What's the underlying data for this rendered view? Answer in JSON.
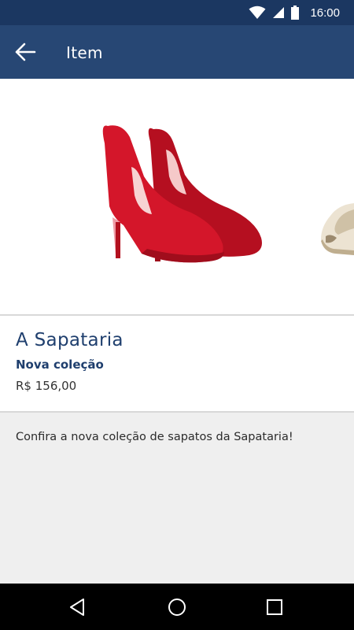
{
  "status_bar": {
    "time": "16:00",
    "icons": [
      "wifi-icon",
      "signal-icon",
      "battery-icon"
    ]
  },
  "app_bar": {
    "title": "Item",
    "back_icon": "arrow-left-icon"
  },
  "gallery": {
    "images": [
      "red-high-heels-image",
      "beige-peep-toe-shoe-image"
    ]
  },
  "item": {
    "title": "A Sapataria",
    "subtitle": "Nova coleção",
    "price": "R$ 156,00"
  },
  "description": "Confira a nova coleção de sapatos da Sapataria!",
  "nav_bar": {
    "buttons": [
      "back-triangle-icon",
      "home-circle-icon",
      "recents-square-icon"
    ]
  },
  "colors": {
    "status_bar": "#1b3761",
    "app_bar": "#274774",
    "title_text": "#1f3f6e",
    "shoe_red": "#d4162a",
    "background": "#efefef"
  }
}
